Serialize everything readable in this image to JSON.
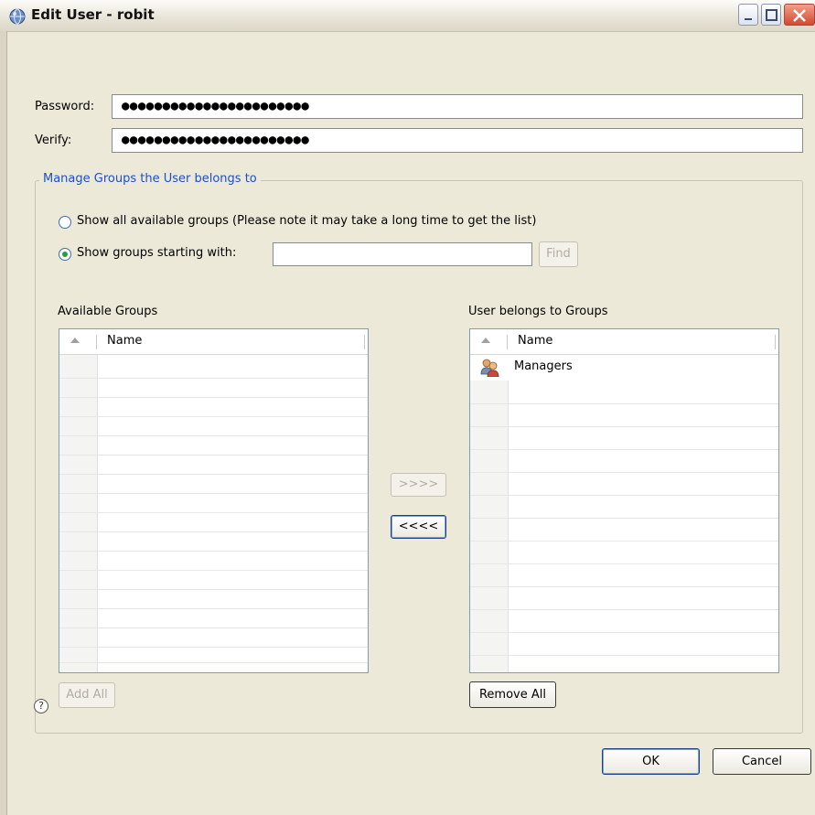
{
  "window": {
    "title": "Edit User - robit",
    "icon": "app-globe-icon"
  },
  "credentials": {
    "password_label": "Password:",
    "password_value": "●●●●●●●●●●●●●●●●●●●●●●●",
    "verify_label": "Verify:",
    "verify_value": "●●●●●●●●●●●●●●●●●●●●●●●"
  },
  "groups_box": {
    "legend": "Manage Groups the User belongs to",
    "radio_all_label": "Show all available groups (Please note it may take a long time to get the list)",
    "radio_all_selected": false,
    "radio_starting_label": "Show groups starting with:",
    "radio_starting_selected": true,
    "search_value": "",
    "find_label": "Find"
  },
  "available_groups": {
    "title": "Available Groups",
    "column": "Name",
    "rows": [],
    "add_all_label": "Add All"
  },
  "transfer": {
    "add_label": ">>>>",
    "remove_label": "<<<<"
  },
  "member_groups": {
    "title": "User belongs to Groups",
    "column": "Name",
    "rows": [
      {
        "name": "Managers",
        "icon": "user-group-icon"
      }
    ],
    "remove_all_label": "Remove All"
  },
  "footer": {
    "help_glyph": "?",
    "ok_label": "OK",
    "cancel_label": "Cancel"
  },
  "colors": {
    "dialog_bg": "#ece9d8",
    "legend_text": "#1c4fcf",
    "close_button": "#d5472f"
  }
}
